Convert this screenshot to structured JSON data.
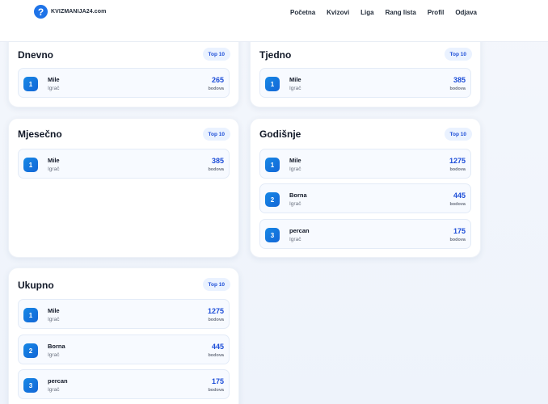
{
  "brand": {
    "logo_glyph": "?",
    "name": "KVIZMANIJA24.com"
  },
  "nav": [
    "Početna",
    "Kvizovi",
    "Liga",
    "Rang lista",
    "Profil",
    "Odjava"
  ],
  "boards": {
    "daily": {
      "title": "Dnevno",
      "badge": "Top 10",
      "rows": [
        {
          "rank": "1",
          "name": "Mile",
          "role": "Igrač",
          "points": "265",
          "unit": "bodova"
        }
      ]
    },
    "weekly": {
      "title": "Tjedno",
      "badge": "Top 10",
      "rows": [
        {
          "rank": "1",
          "name": "Mile",
          "role": "Igrač",
          "points": "385",
          "unit": "bodova"
        }
      ]
    },
    "monthly": {
      "title": "Mjesečno",
      "badge": "Top 10",
      "rows": [
        {
          "rank": "1",
          "name": "Mile",
          "role": "Igrač",
          "points": "385",
          "unit": "bodova"
        }
      ]
    },
    "yearly": {
      "title": "Godišnje",
      "badge": "Top 10",
      "rows": [
        {
          "rank": "1",
          "name": "Mile",
          "role": "Igrač",
          "points": "1275",
          "unit": "bodova"
        },
        {
          "rank": "2",
          "name": "Borna",
          "role": "Igrač",
          "points": "445",
          "unit": "bodova"
        },
        {
          "rank": "3",
          "name": "percan",
          "role": "Igrač",
          "points": "175",
          "unit": "bodova"
        }
      ]
    },
    "total": {
      "title": "Ukupno",
      "badge": "Top 10",
      "rows": [
        {
          "rank": "1",
          "name": "Mile",
          "role": "Igrač",
          "points": "1275",
          "unit": "bodova"
        },
        {
          "rank": "2",
          "name": "Borna",
          "role": "Igrač",
          "points": "445",
          "unit": "bodova"
        },
        {
          "rank": "3",
          "name": "percan",
          "role": "Igrač",
          "points": "175",
          "unit": "bodova"
        }
      ]
    }
  }
}
